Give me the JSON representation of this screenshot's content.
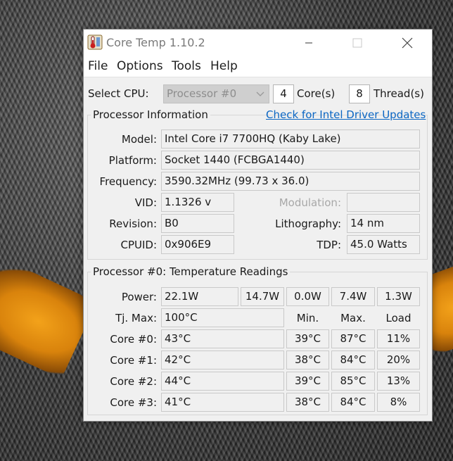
{
  "window": {
    "title": "Core Temp 1.10.2"
  },
  "menu": [
    "File",
    "Options",
    "Tools",
    "Help"
  ],
  "cpu_select": {
    "label": "Select CPU:",
    "selected": "Processor #0",
    "cores_value": "4",
    "cores_label": "Core(s)",
    "threads_value": "8",
    "threads_label": "Thread(s)"
  },
  "processor_info": {
    "title": "Processor Information",
    "link": "Check for Intel Driver Updates",
    "model_label": "Model:",
    "model": "Intel Core i7 7700HQ (Kaby Lake)",
    "platform_label": "Platform:",
    "platform": "Socket 1440 (FCBGA1440)",
    "frequency_label": "Frequency:",
    "frequency": "3590.32MHz (99.73 x 36.0)",
    "vid_label": "VID:",
    "vid": "1.1326 v",
    "modulation_label": "Modulation:",
    "modulation": "",
    "revision_label": "Revision:",
    "revision": "B0",
    "lithography_label": "Lithography:",
    "lithography": "14 nm",
    "cpuid_label": "CPUID:",
    "cpuid": "0x906E9",
    "tdp_label": "TDP:",
    "tdp": "45.0 Watts"
  },
  "temperature": {
    "title": "Processor #0: Temperature Readings",
    "power_label": "Power:",
    "power": [
      "22.1W",
      "14.7W",
      "0.0W",
      "7.4W",
      "1.3W"
    ],
    "tjmax_label": "Tj. Max:",
    "tjmax": "100°C",
    "col_min": "Min.",
    "col_max": "Max.",
    "col_load": "Load",
    "cores": [
      {
        "label": "Core #0:",
        "temp": "43°C",
        "min": "39°C",
        "max": "87°C",
        "load": "11%"
      },
      {
        "label": "Core #1:",
        "temp": "42°C",
        "min": "38°C",
        "max": "84°C",
        "load": "20%"
      },
      {
        "label": "Core #2:",
        "temp": "44°C",
        "min": "39°C",
        "max": "85°C",
        "load": "13%"
      },
      {
        "label": "Core #3:",
        "temp": "41°C",
        "min": "38°C",
        "max": "84°C",
        "load": "8%"
      }
    ]
  }
}
